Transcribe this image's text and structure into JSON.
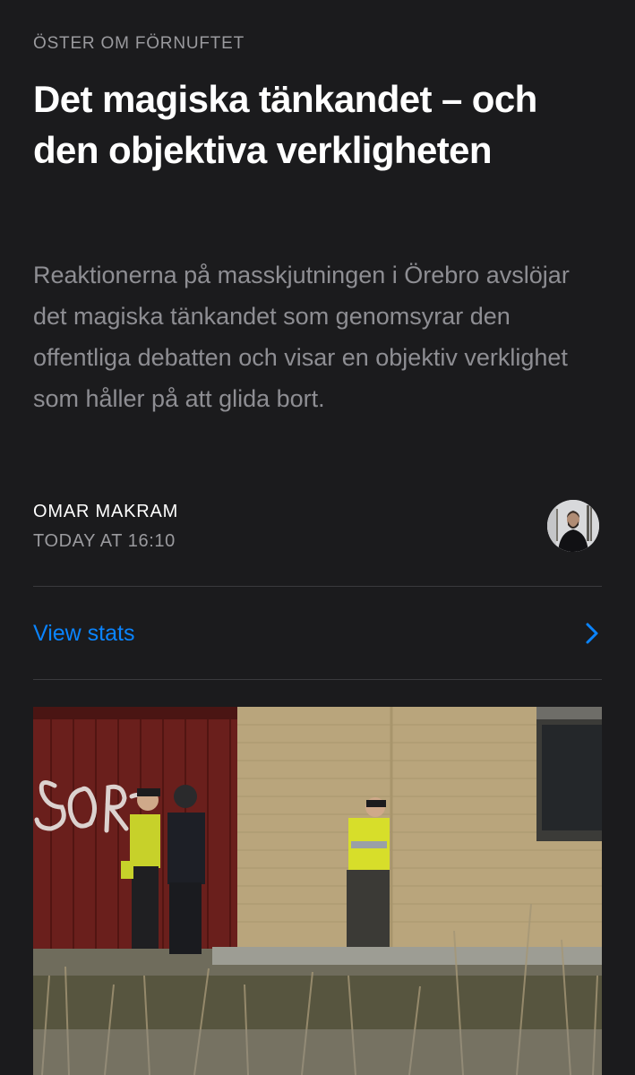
{
  "article": {
    "section": "ÖSTER OM FÖRNUFTET",
    "title": "Det magiska tänkandet – och den objektiva verkligheten",
    "subtitle": "Reaktionerna på masskjutningen i Örebro avslöjar det magiska tänkandet som genomsyrar den offentliga debatten och visar en objektiv verklighet som håller på att glida bort.",
    "author": "OMAR MAKRAM",
    "timestamp": "TODAY AT 16:10"
  },
  "stats": {
    "label": "View stats",
    "chevron_icon": "chevron-right-icon"
  },
  "colors": {
    "background": "#1b1b1d",
    "accent": "#0a84ff",
    "secondary_text": "#8e8e93"
  }
}
